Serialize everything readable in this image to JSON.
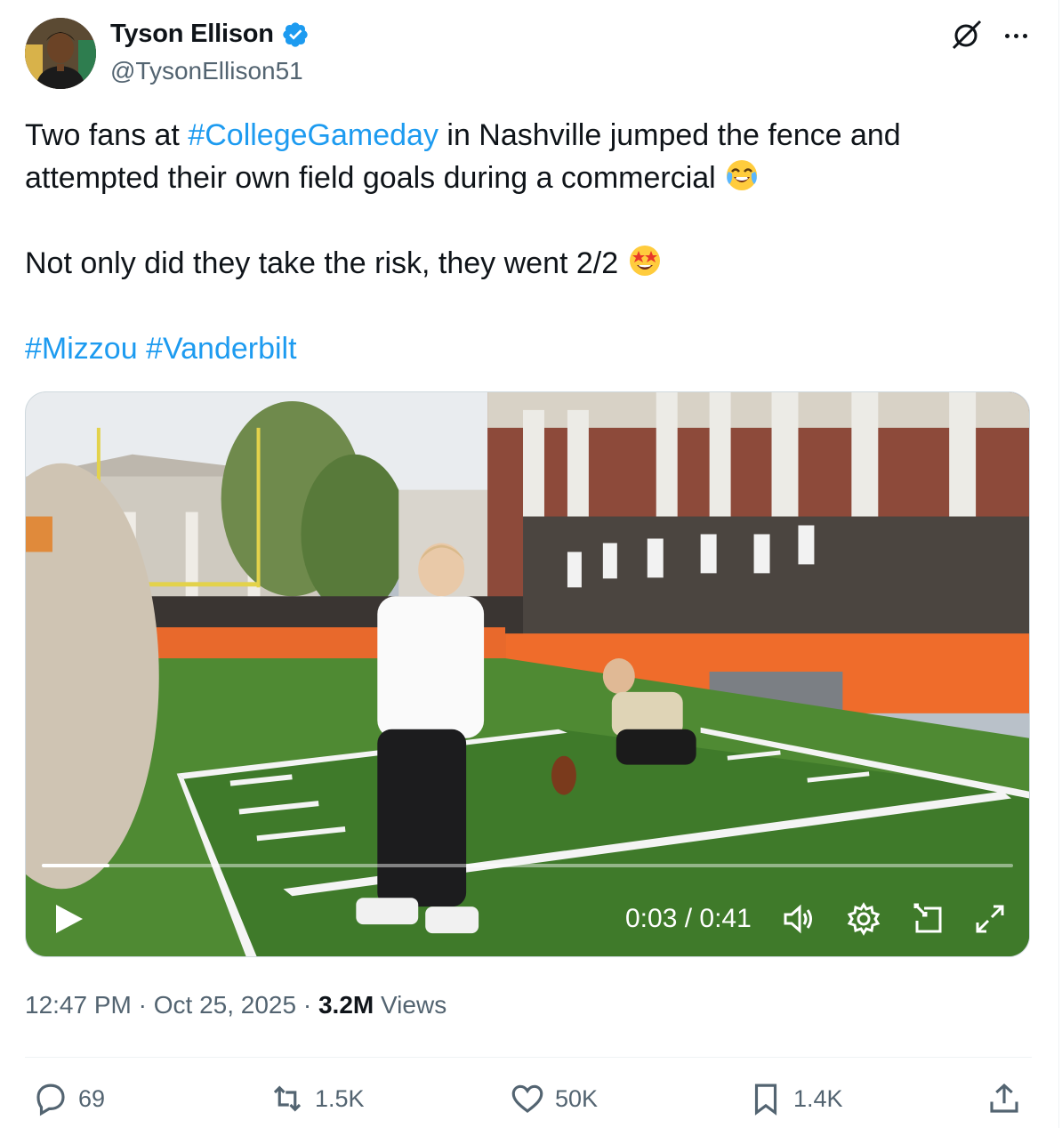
{
  "author": {
    "display_name": "Tyson Ellison",
    "handle": "@TysonEllison51",
    "verified": true
  },
  "tweet": {
    "line1_before": "Two fans at ",
    "hashtag1": "#CollegeGameday",
    "line1_after": " in Nashville jumped the fence and attempted their own field goals during a commercial",
    "emoji1": "face-with-tears-of-joy",
    "line2": "Not only did they take the risk, they went 2/2",
    "emoji2": "star-struck",
    "hashtag2": "#Mizzou",
    "hashtag3": "#Vanderbilt"
  },
  "video": {
    "current_time": "0:03",
    "duration": "0:41",
    "time_display": "0:03 / 0:41",
    "progress_fraction": 0.07,
    "icons": [
      "play-icon",
      "volume-icon",
      "settings-icon",
      "pip-icon",
      "fullscreen-icon"
    ]
  },
  "meta": {
    "time": "12:47 PM",
    "separator": "·",
    "date": "Oct 25, 2025",
    "views_count": "3.2M",
    "views_label": "Views"
  },
  "actions": {
    "replies": "69",
    "reposts": "1.5K",
    "likes": "50K",
    "bookmarks": "1.4K"
  },
  "colors": {
    "accent": "#1d9bf0",
    "text": "#0f1419",
    "secondary": "#536471",
    "verified": "#1d9bf0"
  }
}
